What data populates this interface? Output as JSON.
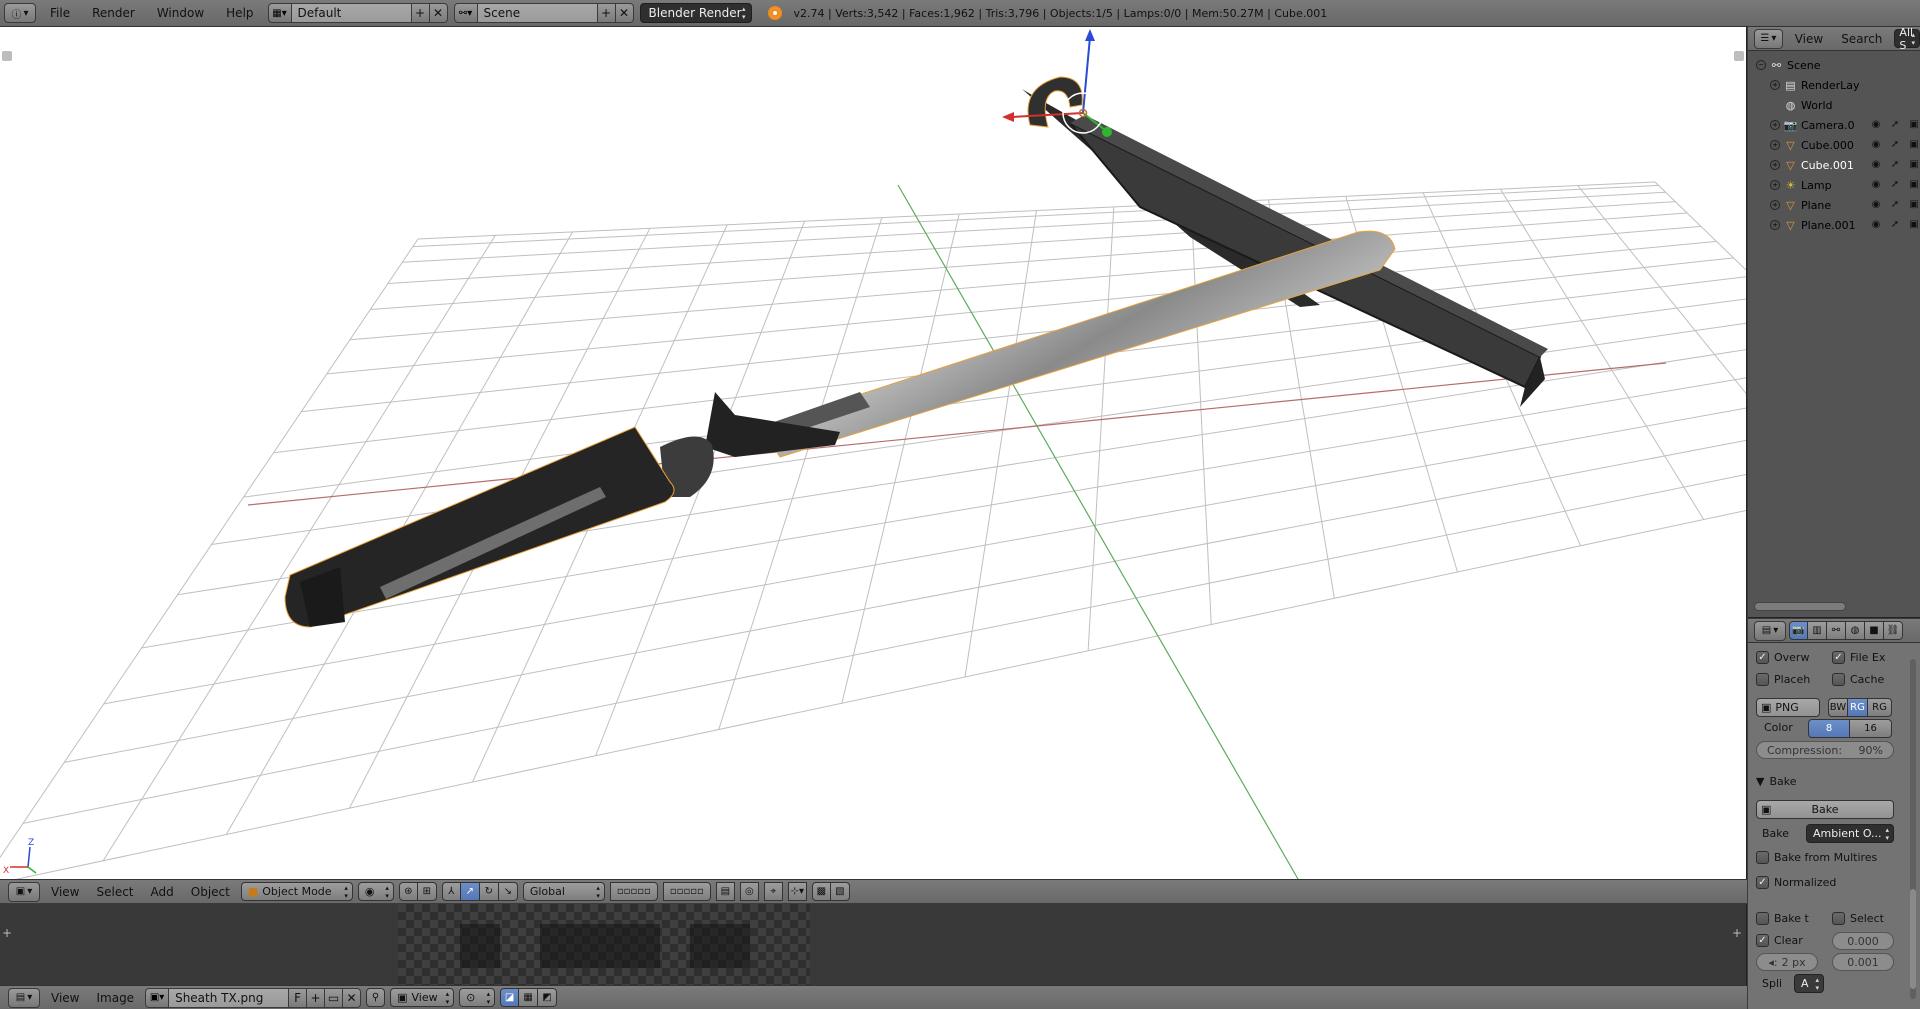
{
  "topbar": {
    "menus": [
      "File",
      "Render",
      "Window",
      "Help"
    ],
    "screen_layout": "Default",
    "scene": "Scene",
    "render_engine": "Blender Render",
    "stats": "v2.74 | Verts:3,542 | Faces:1,962 | Tris:3,796 | Objects:1/5 | Lamps:0/0 | Mem:50.27M | Cube.001"
  },
  "viewport": {
    "axis_labels": {
      "x": "X",
      "z": "Z"
    },
    "colors": {
      "grid": "#bfbfbf",
      "x_axis": "#b65a5a",
      "y_axis": "#5aa85a",
      "selected_outline": "#e9a23b"
    }
  },
  "view3d_header": {
    "menus": [
      "View",
      "Select",
      "Add",
      "Object"
    ],
    "mode": "Object Mode",
    "orientation": "Global"
  },
  "image_header": {
    "menus": [
      "View",
      "Image"
    ],
    "image_name": "Sheath TX.png",
    "fake_user": "F",
    "view_mode": "View"
  },
  "outliner": {
    "menus": [
      "View",
      "Search",
      "All S"
    ],
    "items": [
      {
        "name": "Scene",
        "icon": "scene-icon"
      },
      {
        "name": "RenderLay",
        "icon": "render-layer-icon"
      },
      {
        "name": "World",
        "icon": "world-icon"
      },
      {
        "name": "Camera.0",
        "icon": "camera-icon"
      },
      {
        "name": "Cube.000",
        "icon": "mesh-icon"
      },
      {
        "name": "Cube.001",
        "icon": "mesh-icon"
      },
      {
        "name": "Lamp",
        "icon": "lamp-icon"
      },
      {
        "name": "Plane",
        "icon": "mesh-icon"
      },
      {
        "name": "Plane.001",
        "icon": "mesh-icon"
      }
    ]
  },
  "properties": {
    "overwrite": "Overw",
    "file_ext": "File Ex",
    "placeholders": "Placeh",
    "cache": "Cache",
    "format": "PNG",
    "color_modes": [
      "BW",
      "RG",
      "RG"
    ],
    "color_depth_label": "Color",
    "color_depths": [
      "8",
      "16"
    ],
    "compression": "Compression:",
    "compression_value": "90%",
    "bake_panel": "Bake",
    "bake_button": "Bake",
    "bake_type_label": "Bake",
    "bake_type": "Ambient O...",
    "bake_from_multires": "Bake from Multires",
    "normalized": "Normalized",
    "bake_to": "Bake t",
    "selected": "Select",
    "clear": "Clear",
    "dist_value": "0.000",
    "margin": "2 px",
    "bias_value": "0.001",
    "split_label": "Spli",
    "split_value": "A"
  }
}
